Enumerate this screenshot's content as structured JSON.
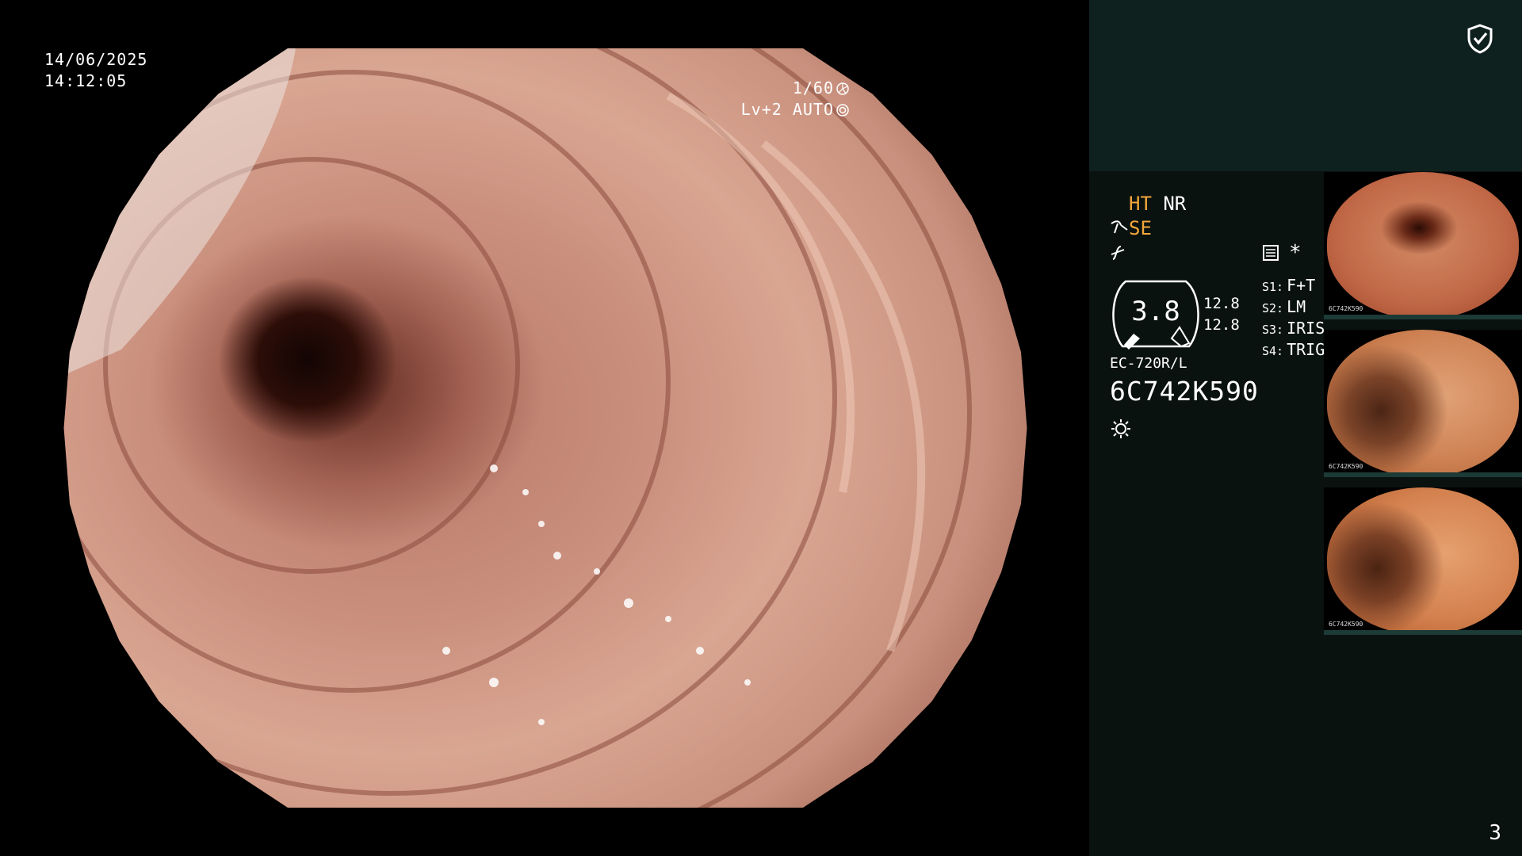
{
  "osd": {
    "date": "14/06/2025",
    "time": "14:12:05",
    "shutter": "1/60",
    "level": "Lv+2 AUTO"
  },
  "panel": {
    "mode_ht": "HT",
    "mode_nr": "NR",
    "mode_se": "SE",
    "gauge_value": "3.8",
    "gauge_side_top": "12.8",
    "gauge_side_bottom": "12.8",
    "switches": [
      {
        "key": "S1:",
        "value": "F+T"
      },
      {
        "key": "S2:",
        "value": "LM"
      },
      {
        "key": "S3:",
        "value": "IRIS"
      },
      {
        "key": "S4:",
        "value": "TRIG"
      }
    ],
    "scope_model": "EC-720R/L",
    "serial": "6C742K590",
    "asterisk": "*",
    "page_number": "3"
  },
  "thumbnails": [
    {
      "stamp": "6C742K590"
    },
    {
      "stamp": "6C742K590"
    },
    {
      "stamp": "6C742K590"
    }
  ],
  "colors": {
    "panel_top": "#0e211e",
    "panel_bg": "#0a1210",
    "highlight": "#f3a73b"
  },
  "icons": [
    "shutter-icon",
    "auto-iris-icon",
    "shield-check-icon",
    "scope-icon",
    "function-icon",
    "settings-icon",
    "light-icon"
  ]
}
